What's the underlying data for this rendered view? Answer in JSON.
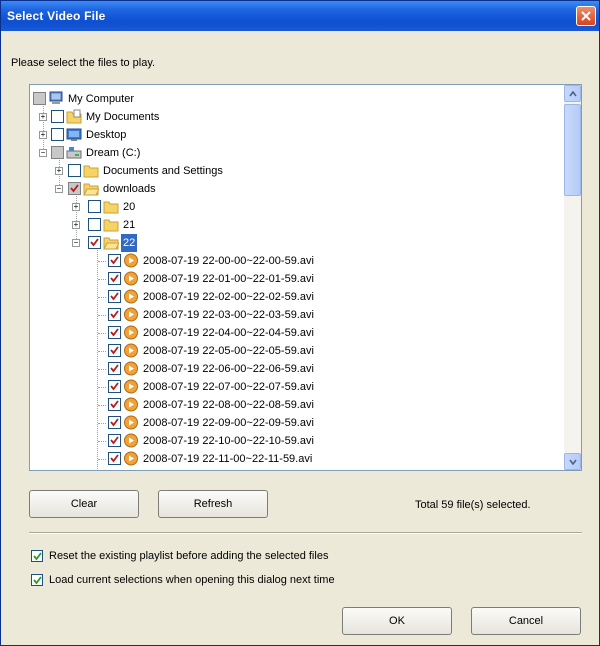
{
  "window": {
    "title": "Select Video File"
  },
  "prompt": "Please select the files to play.",
  "tree": {
    "root": "My Computer",
    "my_documents": "My Documents",
    "desktop": "Desktop",
    "drive": "Dream (C:)",
    "docs_settings": "Documents and Settings",
    "downloads": "downloads",
    "folder_20": "20",
    "folder_21": "21",
    "folder_22": "22",
    "files": [
      "2008-07-19 22-00-00~22-00-59.avi",
      "2008-07-19 22-01-00~22-01-59.avi",
      "2008-07-19 22-02-00~22-02-59.avi",
      "2008-07-19 22-03-00~22-03-59.avi",
      "2008-07-19 22-04-00~22-04-59.avi",
      "2008-07-19 22-05-00~22-05-59.avi",
      "2008-07-19 22-06-00~22-06-59.avi",
      "2008-07-19 22-07-00~22-07-59.avi",
      "2008-07-19 22-08-00~22-08-59.avi",
      "2008-07-19 22-09-00~22-09-59.avi",
      "2008-07-19 22-10-00~22-10-59.avi",
      "2008-07-19 22-11-00~22-11-59.avi"
    ]
  },
  "buttons": {
    "clear": "Clear",
    "refresh": "Refresh",
    "ok": "OK",
    "cancel": "Cancel"
  },
  "total": "Total 59 file(s) selected.",
  "options": {
    "reset_playlist": "Reset the existing playlist before adding the selected files",
    "load_selections": "Load current selections when opening this dialog next time"
  },
  "colors": {
    "titlebar": "#0d4fd0",
    "selection": "#316ac5",
    "dialog_bg": "#ece9d8"
  }
}
